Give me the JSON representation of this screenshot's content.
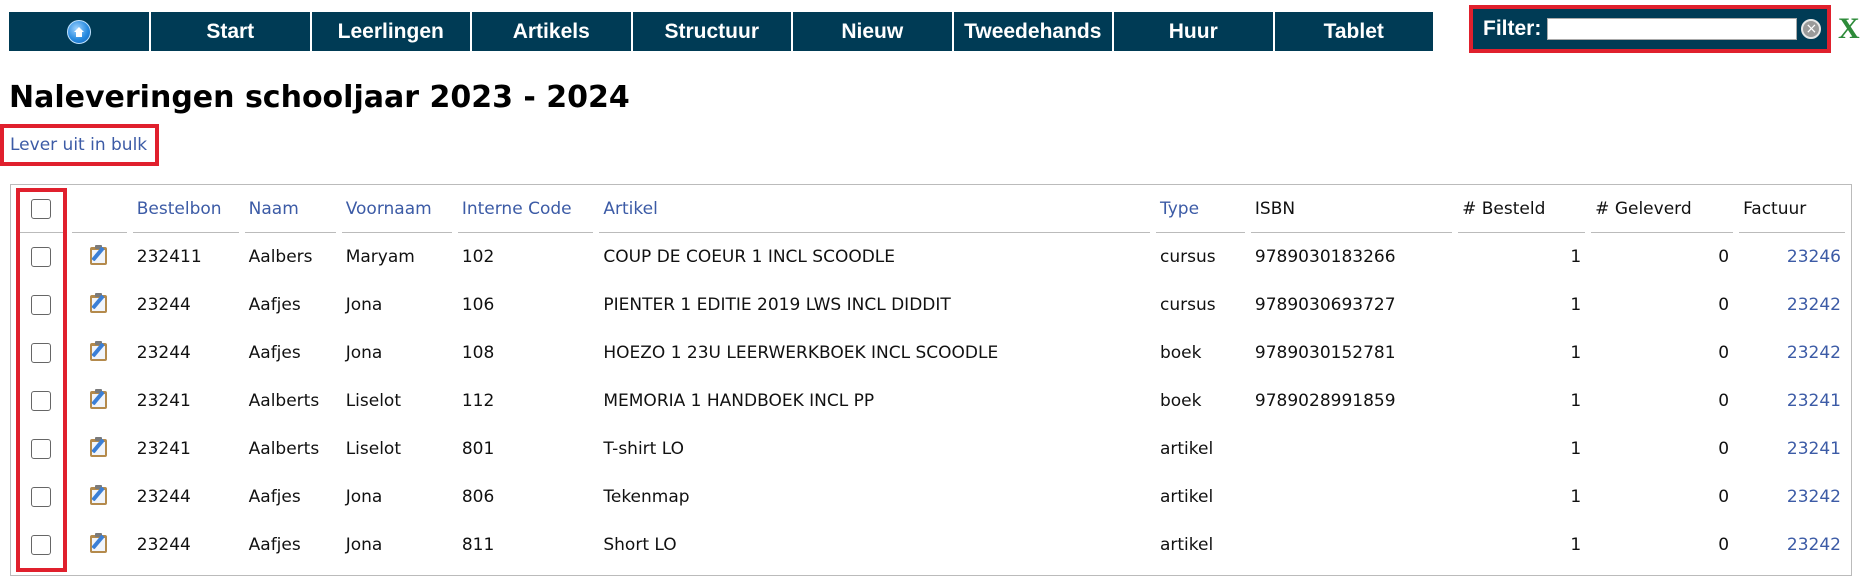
{
  "nav": {
    "home_icon": "home-icon",
    "items": [
      "Start",
      "Leerlingen",
      "Artikels",
      "Structuur",
      "Nieuw",
      "Tweedehands",
      "Huur",
      "Tablet"
    ]
  },
  "filter": {
    "label": "Filter:",
    "value": "",
    "clear_icon": "clear-circle-icon",
    "close_label": "X"
  },
  "page": {
    "title": "Naleveringen schooljaar 2023 - 2024",
    "bulk_link": "Lever uit in bulk"
  },
  "table": {
    "headers": {
      "bestelbon": "Bestelbon",
      "naam": "Naam",
      "voornaam": "Voornaam",
      "interne_code": "Interne Code",
      "artikel": "Artikel",
      "type": "Type",
      "isbn": "ISBN",
      "besteld": "# Besteld",
      "geleverd": "# Geleverd",
      "factuur": "Factuur"
    },
    "rows": [
      {
        "bestelbon": "232411",
        "naam": "Aalbers",
        "voornaam": "Maryam",
        "interne_code": "102",
        "artikel": "COUP DE COEUR 1 INCL SCOODLE",
        "type": "cursus",
        "isbn": "9789030183266",
        "besteld": "1",
        "geleverd": "0",
        "factuur": "23246"
      },
      {
        "bestelbon": "23244",
        "naam": "Aafjes",
        "voornaam": "Jona",
        "interne_code": "106",
        "artikel": "PIENTER 1 EDITIE 2019 LWS INCL DIDDIT",
        "type": "cursus",
        "isbn": "9789030693727",
        "besteld": "1",
        "geleverd": "0",
        "factuur": "23242"
      },
      {
        "bestelbon": "23244",
        "naam": "Aafjes",
        "voornaam": "Jona",
        "interne_code": "108",
        "artikel": "HOEZO 1 23U LEERWERKBOEK INCL SCOODLE",
        "type": "boek",
        "isbn": "9789030152781",
        "besteld": "1",
        "geleverd": "0",
        "factuur": "23242"
      },
      {
        "bestelbon": "23241",
        "naam": "Aalberts",
        "voornaam": "Liselot",
        "interne_code": "112",
        "artikel": "MEMORIA 1 HANDBOEK INCL PP",
        "type": "boek",
        "isbn": "9789028991859",
        "besteld": "1",
        "geleverd": "0",
        "factuur": "23241"
      },
      {
        "bestelbon": "23241",
        "naam": "Aalberts",
        "voornaam": "Liselot",
        "interne_code": "801",
        "artikel": "T-shirt LO",
        "type": "artikel",
        "isbn": "",
        "besteld": "1",
        "geleverd": "0",
        "factuur": "23241"
      },
      {
        "bestelbon": "23244",
        "naam": "Aafjes",
        "voornaam": "Jona",
        "interne_code": "806",
        "artikel": "Tekenmap",
        "type": "artikel",
        "isbn": "",
        "besteld": "1",
        "geleverd": "0",
        "factuur": "23242"
      },
      {
        "bestelbon": "23244",
        "naam": "Aafjes",
        "voornaam": "Jona",
        "interne_code": "811",
        "artikel": "Short LO",
        "type": "artikel",
        "isbn": "",
        "besteld": "1",
        "geleverd": "0",
        "factuur": "23242"
      }
    ]
  },
  "colors": {
    "nav_bg": "#003b55",
    "link": "#3c5ba6",
    "highlight": "#e0202d",
    "close_x": "#2e8b3a"
  }
}
